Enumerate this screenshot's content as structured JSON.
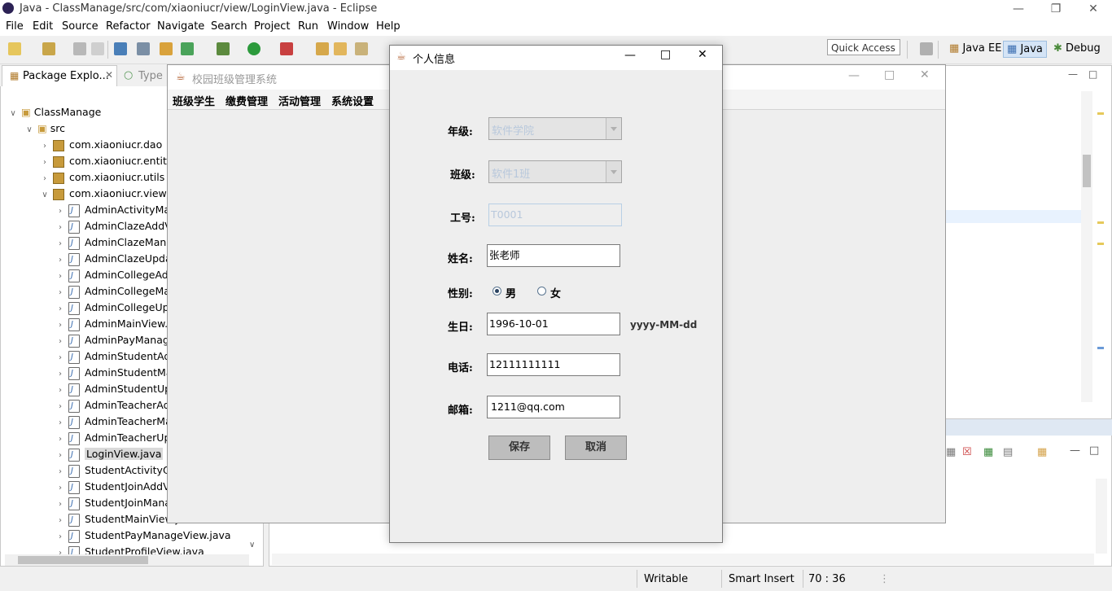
{
  "eclipse": {
    "title": "Java - ClassManage/src/com/xiaoniucr/view/LoginView.java - Eclipse",
    "menu": [
      "File",
      "Edit",
      "Source",
      "Refactor",
      "Navigate",
      "Search",
      "Project",
      "Run",
      "Window",
      "Help"
    ],
    "quick_access": "Quick Access",
    "perspectives": [
      "Java EE",
      "Java",
      "Debug"
    ],
    "package_explorer": {
      "tab_label": "Package Explo...",
      "tab2_label": "Type",
      "tree": [
        {
          "label": "ClassManage",
          "level": 0,
          "type": "project",
          "expanded": true
        },
        {
          "label": "src",
          "level": 1,
          "type": "srcfolder",
          "expanded": true
        },
        {
          "label": "com.xiaoniucr.dao",
          "level": 2,
          "type": "package",
          "expanded": false
        },
        {
          "label": "com.xiaoniucr.entity",
          "level": 2,
          "type": "package",
          "expanded": false
        },
        {
          "label": "com.xiaoniucr.utils",
          "level": 2,
          "type": "package",
          "expanded": false
        },
        {
          "label": "com.xiaoniucr.view",
          "level": 2,
          "type": "package",
          "expanded": true
        },
        {
          "label": "AdminActivityMan",
          "level": 3,
          "type": "java"
        },
        {
          "label": "AdminClazeAddV",
          "level": 3,
          "type": "java"
        },
        {
          "label": "AdminClazeMana",
          "level": 3,
          "type": "java"
        },
        {
          "label": "AdminClazeUpda",
          "level": 3,
          "type": "java"
        },
        {
          "label": "AdminCollegeAdc",
          "level": 3,
          "type": "java"
        },
        {
          "label": "AdminCollegeMa",
          "level": 3,
          "type": "java"
        },
        {
          "label": "AdminCollegeUpc",
          "level": 3,
          "type": "java"
        },
        {
          "label": "AdminMainView.j",
          "level": 3,
          "type": "java"
        },
        {
          "label": "AdminPayManage",
          "level": 3,
          "type": "java"
        },
        {
          "label": "AdminStudentAdc",
          "level": 3,
          "type": "java"
        },
        {
          "label": "AdminStudentMa",
          "level": 3,
          "type": "java"
        },
        {
          "label": "AdminStudentUpc",
          "level": 3,
          "type": "java"
        },
        {
          "label": "AdminTeacherAd",
          "level": 3,
          "type": "java"
        },
        {
          "label": "AdminTeacherMa",
          "level": 3,
          "type": "java"
        },
        {
          "label": "AdminTeacherUp",
          "level": 3,
          "type": "java"
        },
        {
          "label": "LoginView.java",
          "level": 3,
          "type": "java",
          "selected": true
        },
        {
          "label": "StudentActivityQu",
          "level": 3,
          "type": "java"
        },
        {
          "label": "StudentJoinAddV",
          "level": 3,
          "type": "java"
        },
        {
          "label": "StudentJoinMana",
          "level": 3,
          "type": "java"
        },
        {
          "label": "StudentMainView.java",
          "level": 3,
          "type": "java"
        },
        {
          "label": "StudentPayManageView.java",
          "level": 3,
          "type": "java"
        },
        {
          "label": "StudentProfileView.java",
          "level": 3,
          "type": "java"
        }
      ]
    },
    "status": {
      "writable": "Writable",
      "insert_mode": "Smart Insert",
      "position": "70 : 36"
    }
  },
  "main_window": {
    "title": "校园班级管理系统",
    "menu": [
      "班级学生",
      "缴费管理",
      "活动管理",
      "系统设置"
    ]
  },
  "dialog": {
    "title": "个人信息",
    "grade_label": "年级:",
    "grade_value": "软件学院",
    "class_label": "班级:",
    "class_value": "软件1班",
    "id_label": "工号:",
    "id_value": "T0001",
    "name_label": "姓名:",
    "name_value": "张老师",
    "gender_label": "性别:",
    "gender_male": "男",
    "gender_female": "女",
    "gender_selected": "男",
    "birthday_label": "生日:",
    "birthday_value": "1996-10-01",
    "birthday_hint": "yyyy-MM-dd",
    "phone_label": "电话:",
    "phone_value": "12111111111",
    "email_label": "邮箱:",
    "email_value": "1211@qq.com",
    "save_label": "保存",
    "cancel_label": "取消"
  },
  "colors": {
    "selection": "#d9d9d9",
    "eclipse_logo": "#2c2255"
  }
}
